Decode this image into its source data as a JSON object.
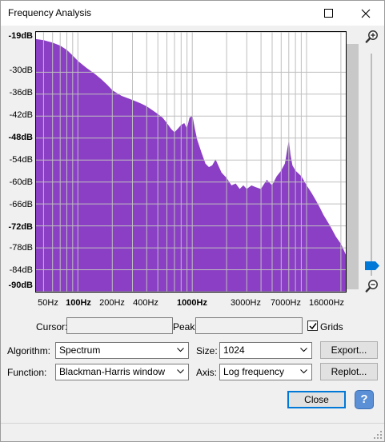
{
  "window": {
    "title": "Frequency Analysis",
    "buttons": {
      "maximize": "maximize-icon",
      "close": "close-icon"
    }
  },
  "plot": {
    "fill_color": "#8a3fc4",
    "grid_color": "#bfbfbf",
    "db_labels": [
      "-19dB",
      "-30dB",
      "-36dB",
      "-42dB",
      "-48dB",
      "-54dB",
      "-60dB",
      "-66dB",
      "-72dB",
      "-78dB",
      "-84dB",
      "-90dB"
    ],
    "hz_labels": [
      "50Hz",
      "100Hz",
      "200Hz",
      "400Hz",
      "1000Hz",
      "3000Hz",
      "7000Hz",
      "16000Hz"
    ],
    "db_range": [
      -90,
      -19
    ],
    "freq_range_hz": [
      43,
      22050
    ],
    "scale": "log frequency"
  },
  "spectrum": {
    "freq_hz": [
      43,
      50,
      60,
      70,
      80,
      90,
      100,
      120,
      140,
      160,
      180,
      200,
      240,
      280,
      320,
      360,
      400,
      450,
      500,
      550,
      600,
      650,
      700,
      750,
      800,
      850,
      900,
      950,
      1000,
      1050,
      1100,
      1200,
      1300,
      1400,
      1500,
      1600,
      1800,
      2000,
      2200,
      2400,
      2600,
      2800,
      3000,
      3300,
      3600,
      4000,
      4500,
      5000,
      5500,
      6000,
      6500,
      7000,
      7200,
      7500,
      8000,
      9000,
      10000,
      11000,
      12000,
      13000,
      14000,
      16000,
      18000,
      20000,
      22050
    ],
    "db": [
      -21,
      -21.3,
      -22,
      -22.8,
      -24,
      -25.5,
      -27,
      -29,
      -30.5,
      -32,
      -33.5,
      -35,
      -36.5,
      -37.3,
      -38,
      -38.7,
      -39.4,
      -40.5,
      -41.5,
      -42.5,
      -44,
      -45.5,
      -46.5,
      -45.5,
      -44.5,
      -44,
      -45.5,
      -42.5,
      -42,
      -45.5,
      -48.5,
      -52,
      -55,
      -56,
      -55.5,
      -54,
      -57.5,
      -59,
      -61,
      -60.5,
      -62,
      -61,
      -62,
      -61,
      -61.5,
      -62,
      -59.5,
      -61,
      -58.5,
      -57,
      -55,
      -49,
      -52.5,
      -55.5,
      -57,
      -58.5,
      -61,
      -63,
      -65,
      -67,
      -69,
      -72,
      -75,
      -77,
      -80
    ]
  },
  "cursor": {
    "label": "Cursor:",
    "value": ""
  },
  "peak": {
    "label": "Peak:",
    "value": ""
  },
  "grids": {
    "label": "Grids",
    "checked": true
  },
  "algorithm": {
    "label": "Algorithm:",
    "value": "Spectrum"
  },
  "size": {
    "label": "Size:",
    "value": "1024"
  },
  "function": {
    "label": "Function:",
    "value": "Blackman-Harris window"
  },
  "axis": {
    "label": "Axis:",
    "value": "Log frequency"
  },
  "buttons": {
    "export": "Export...",
    "replot": "Replot...",
    "close": "Close",
    "help": "?"
  }
}
